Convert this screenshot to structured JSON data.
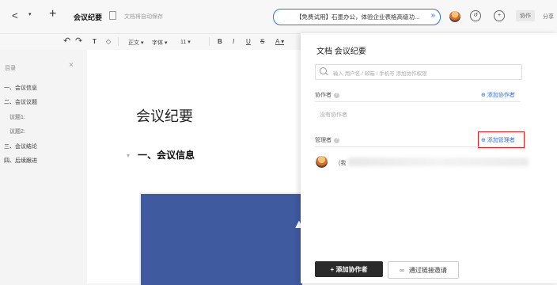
{
  "topbar": {
    "back_icon": "<",
    "dropdown_icon": "▾",
    "plus_icon": "+",
    "doc_title": "会议纪要",
    "save_status": "文档将自动保存",
    "promo_text": "【免费试用】石墨办公，体验企业表格高级功...",
    "promo_arrow": "»",
    "collab_label": "协作",
    "share_label": "分享"
  },
  "toolbar": {
    "undo": "↶",
    "redo": "↷",
    "format_painter": "T",
    "clear": "◇",
    "paragraph": "正文 ▾",
    "font": "字体 ▾",
    "size": "11 ▾",
    "bold": "B",
    "italic": "I",
    "underline": "U",
    "strike": "S",
    "color": "A ▾"
  },
  "sidebar": {
    "label": "目录",
    "close": "×",
    "items": [
      {
        "text": "一、会议信息",
        "level": 1
      },
      {
        "text": "二、会议议题",
        "level": 1
      },
      {
        "text": "议题1:",
        "level": 2
      },
      {
        "text": "议题2:",
        "level": 2
      },
      {
        "text": "三、会议结论",
        "level": 1
      },
      {
        "text": "四、后续跟进",
        "level": 1
      }
    ]
  },
  "document": {
    "heading": "会议纪要",
    "section_arrow": "▾",
    "section_heading": "一、会议信息"
  },
  "panel": {
    "title": "文档 会议纪要",
    "search_placeholder": "输入 用户名 / 邮箱 / 手机号 添加协作权限",
    "collaborators_label": "协作者",
    "add_collaborator_link": "⊕ 添加协作者",
    "no_collaborators": "没有协作者",
    "managers_label": "管理者",
    "add_manager_link": "⊕ 添加管理者",
    "manager_name": "(我",
    "add_collab_button": "+ 添加协作者",
    "invite_button": "通过链接邀请",
    "help": "?"
  },
  "colors": {
    "accent": "#2f72e8",
    "highlight_box": "#e02020",
    "dark_button": "#2b2b2b",
    "image_fill": "#3f5a9f"
  }
}
